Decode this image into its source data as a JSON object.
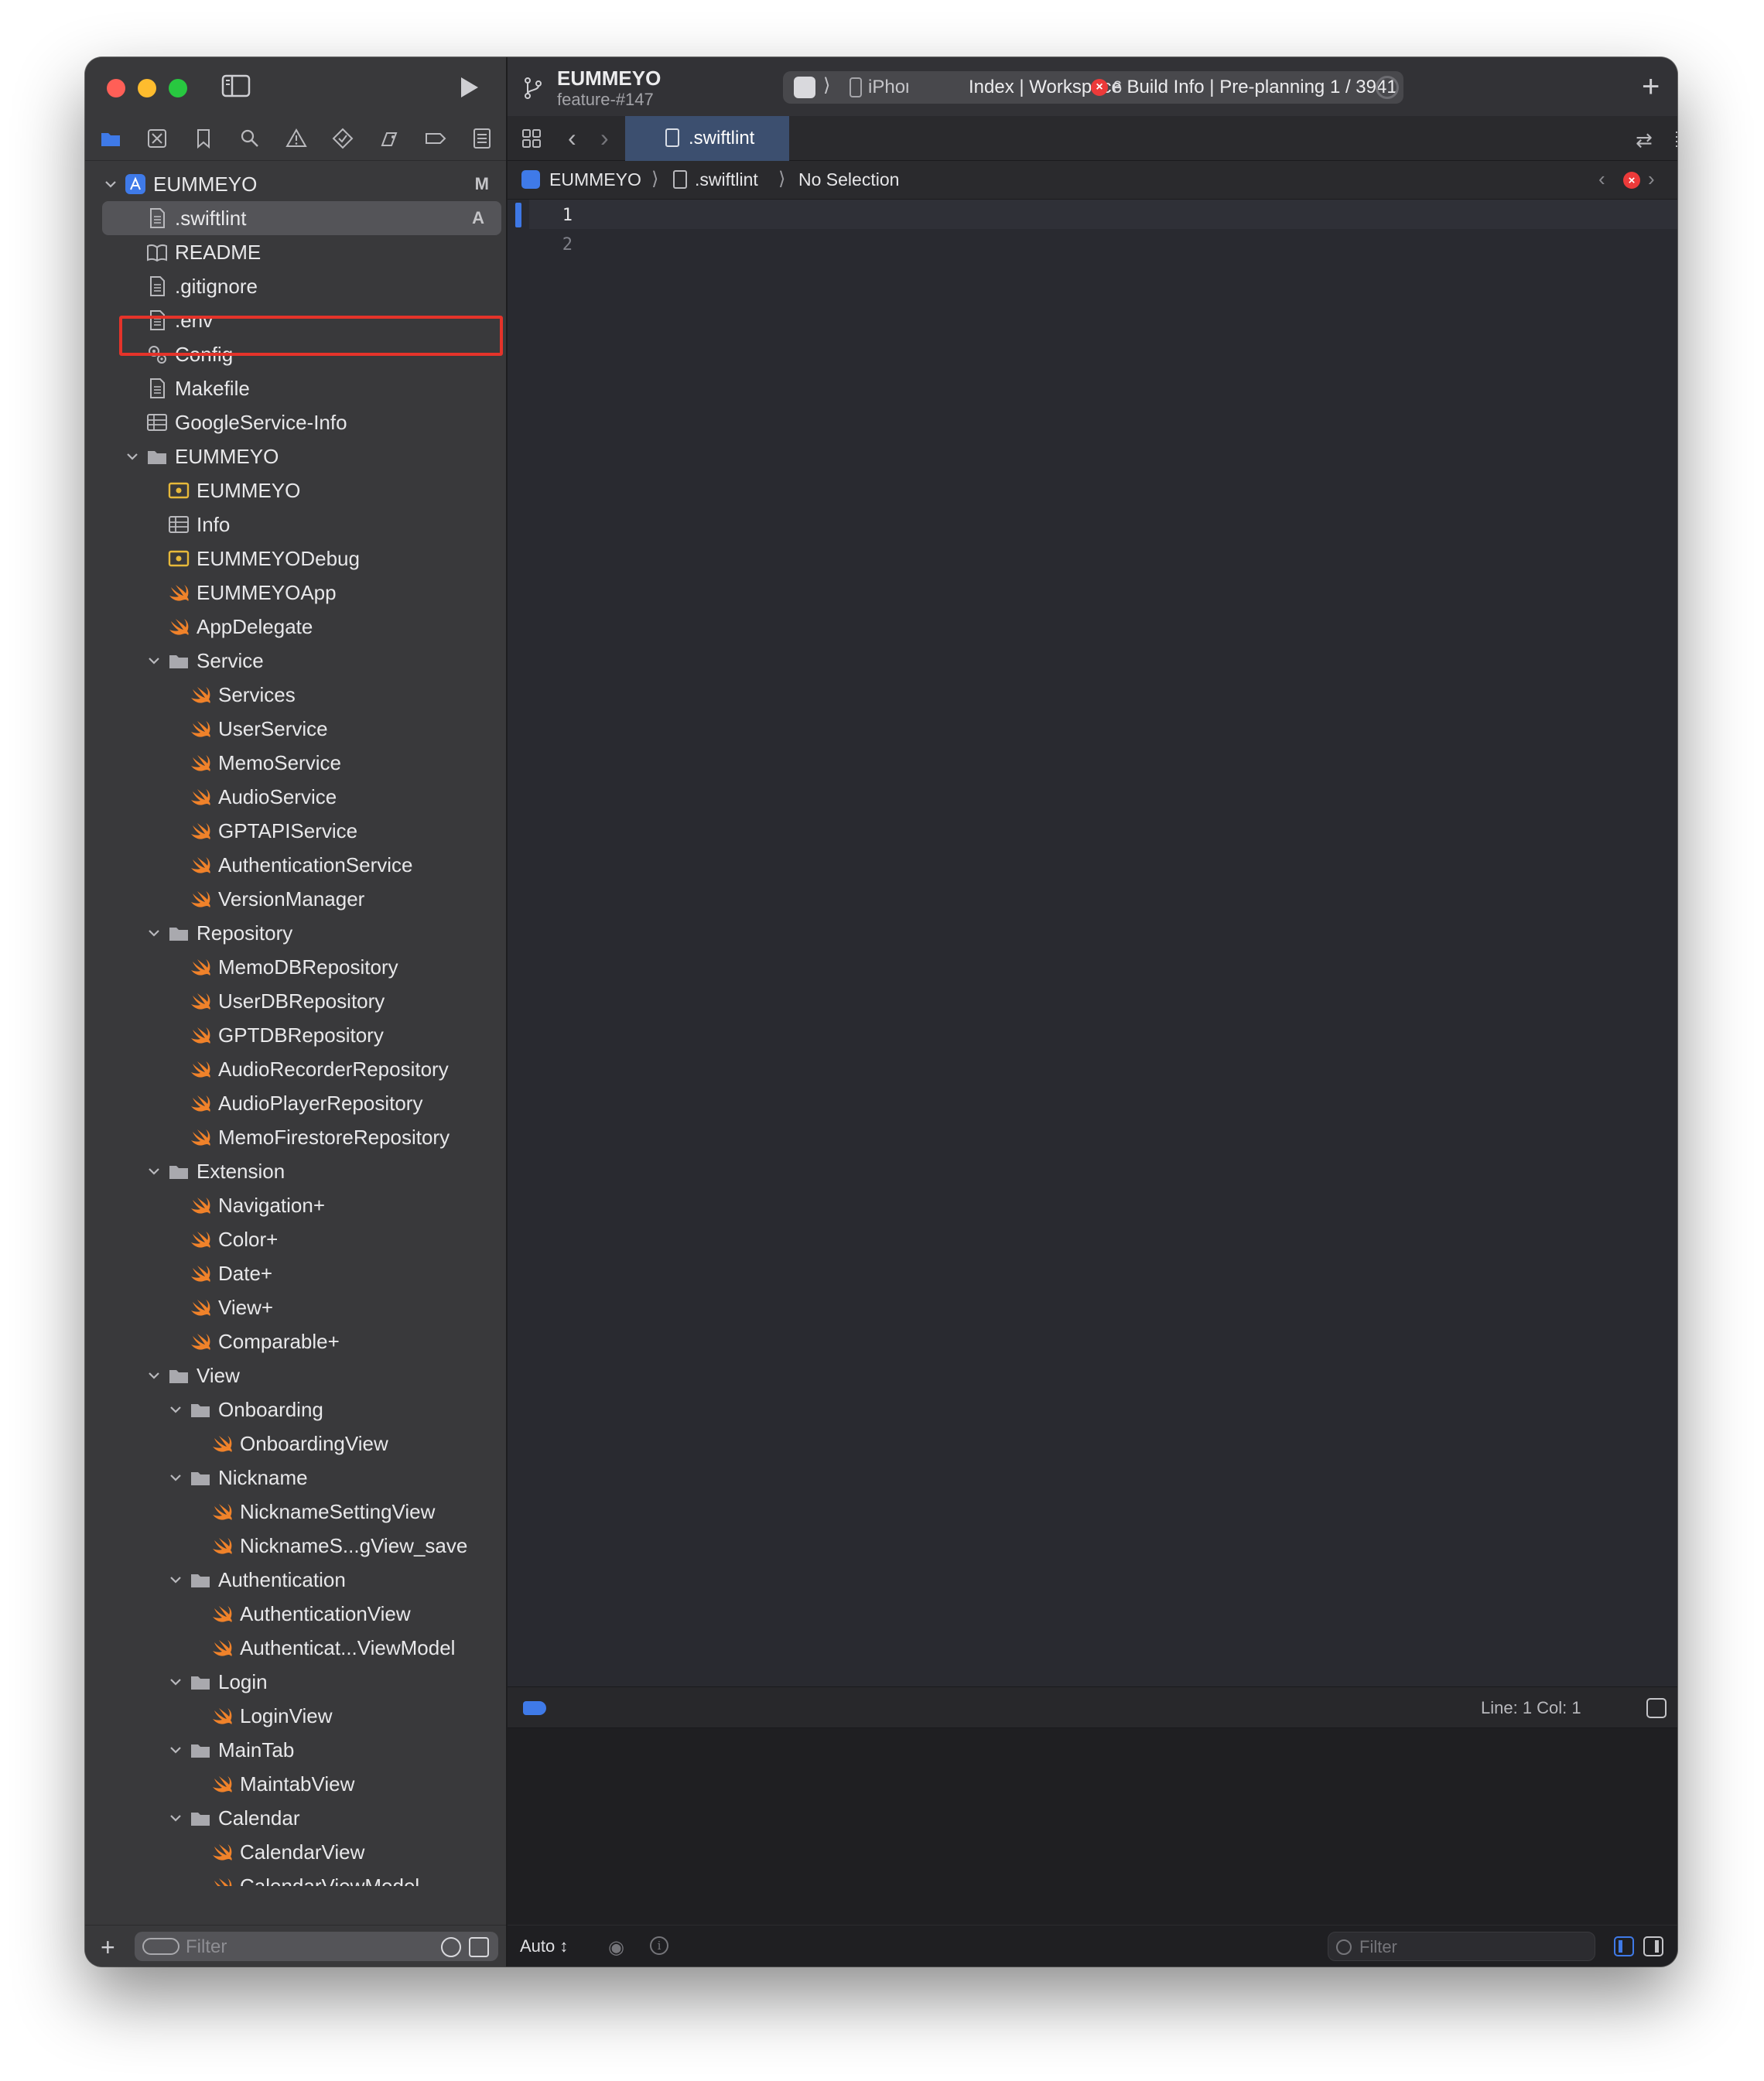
{
  "toolbar": {
    "project_name": "EUMMEYO",
    "branch": "feature-#147",
    "scheme_separator": "⟩",
    "device": "iPhone",
    "status": "Index | Workspace Build Info  | Pre-planning 1 / 3941",
    "error_count": "6",
    "error_glyph": "×",
    "plus": "+"
  },
  "tab": {
    "label": ".swiftlint"
  },
  "jumpbar": {
    "project": "EUMMEYO",
    "sep": "⟩",
    "file": ".swiftlint",
    "selection": "No Selection",
    "error_glyph": "×"
  },
  "editor": {
    "line_numbers": [
      "1",
      "2"
    ]
  },
  "debugbar": {
    "line_col": "Line: 1  Col: 1"
  },
  "bottombar": {
    "auto": "Auto ↕",
    "filter_placeholder": "Filter"
  },
  "sidebar": {
    "filter_placeholder": "Filter",
    "plus": "+",
    "items": [
      {
        "label": "EUMMEYO",
        "badge": "M"
      },
      {
        "label": ".swiftlint",
        "badge": "A"
      },
      {
        "label": "README"
      },
      {
        "label": ".gitignore"
      },
      {
        "label": ".env"
      },
      {
        "label": "Config"
      },
      {
        "label": "Makefile"
      },
      {
        "label": "GoogleService-Info"
      },
      {
        "label": "EUMMEYO"
      },
      {
        "label": "EUMMEYO"
      },
      {
        "label": "Info"
      },
      {
        "label": "EUMMEYODebug"
      },
      {
        "label": "EUMMEYOApp"
      },
      {
        "label": "AppDelegate"
      },
      {
        "label": "Service"
      },
      {
        "label": "Services"
      },
      {
        "label": "UserService"
      },
      {
        "label": "MemoService"
      },
      {
        "label": "AudioService"
      },
      {
        "label": "GPTAPIService"
      },
      {
        "label": "AuthenticationService"
      },
      {
        "label": "VersionManager"
      },
      {
        "label": "Repository"
      },
      {
        "label": "MemoDBRepository"
      },
      {
        "label": "UserDBRepository"
      },
      {
        "label": "GPTDBRepository"
      },
      {
        "label": "AudioRecorderRepository"
      },
      {
        "label": "AudioPlayerRepository"
      },
      {
        "label": "MemoFirestoreRepository"
      },
      {
        "label": "Extension"
      },
      {
        "label": "Navigation+"
      },
      {
        "label": "Color+"
      },
      {
        "label": "Date+"
      },
      {
        "label": "View+"
      },
      {
        "label": "Comparable+"
      },
      {
        "label": "View"
      },
      {
        "label": "Onboarding"
      },
      {
        "label": "OnboardingView"
      },
      {
        "label": "Nickname"
      },
      {
        "label": "NicknameSettingView"
      },
      {
        "label": "NicknameS...gView_save"
      },
      {
        "label": "Authentication"
      },
      {
        "label": "AuthenticationView"
      },
      {
        "label": "Authenticat...ViewModel"
      },
      {
        "label": "Login"
      },
      {
        "label": "LoginView"
      },
      {
        "label": "MainTab"
      },
      {
        "label": "MaintabView"
      },
      {
        "label": "Calendar"
      },
      {
        "label": "CalendarView"
      },
      {
        "label": "CalendarViewModel"
      }
    ]
  }
}
